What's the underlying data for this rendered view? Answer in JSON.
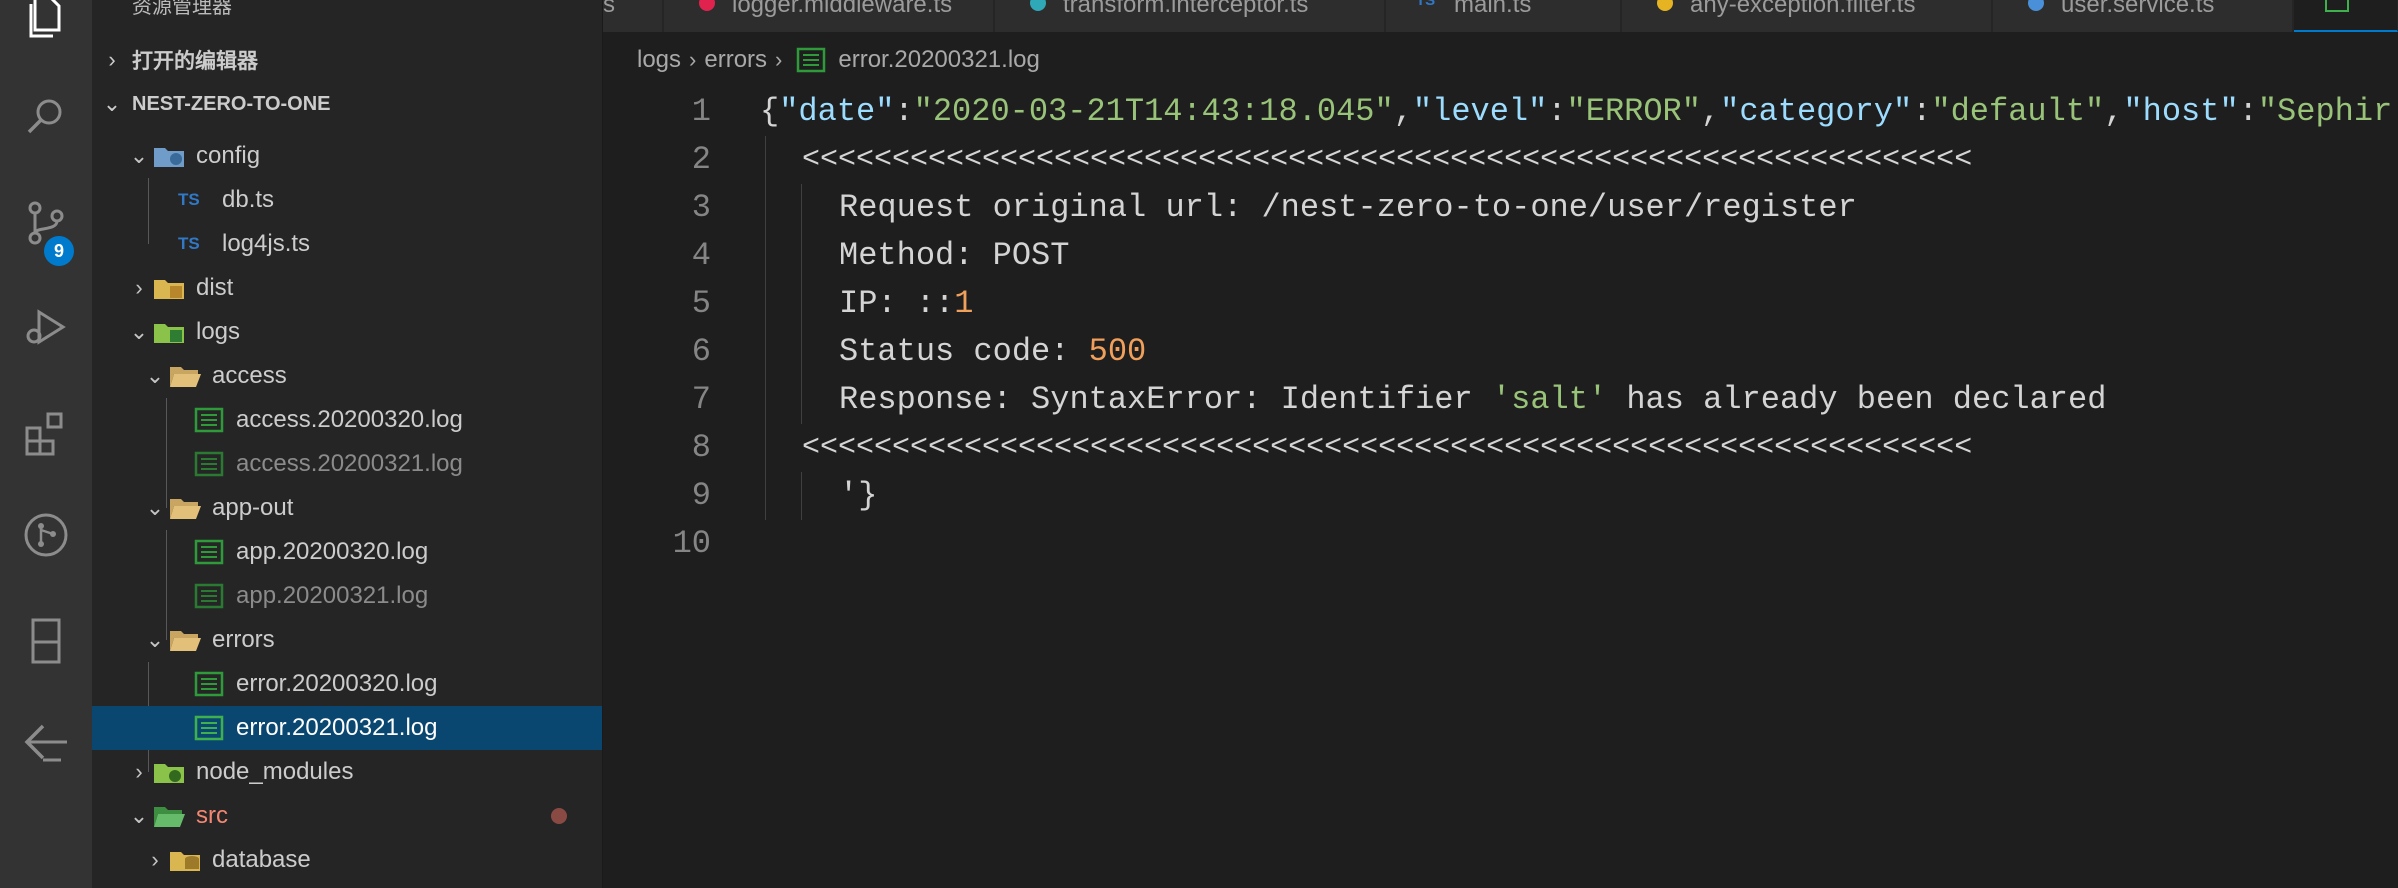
{
  "sidebar": {
    "title": "资源管理器",
    "open_editors_label": "打开的编辑器",
    "project_label": "NEST-ZERO-TO-ONE",
    "items": [
      {
        "label": "config",
        "kind": "folder",
        "state": "open"
      },
      {
        "label": "db.ts",
        "kind": "ts"
      },
      {
        "label": "log4js.ts",
        "kind": "ts"
      },
      {
        "label": "dist",
        "kind": "folder",
        "state": "closed"
      },
      {
        "label": "logs",
        "kind": "folder",
        "state": "open"
      },
      {
        "label": "access",
        "kind": "folder",
        "state": "open"
      },
      {
        "label": "access.20200320.log",
        "kind": "log"
      },
      {
        "label": "access.20200321.log",
        "kind": "log"
      },
      {
        "label": "app-out",
        "kind": "folder",
        "state": "open"
      },
      {
        "label": "app.20200320.log",
        "kind": "log"
      },
      {
        "label": "app.20200321.log",
        "kind": "log"
      },
      {
        "label": "errors",
        "kind": "folder",
        "state": "open"
      },
      {
        "label": "error.20200320.log",
        "kind": "log"
      },
      {
        "label": "error.20200321.log",
        "kind": "log",
        "selected": true
      },
      {
        "label": "node_modules",
        "kind": "folder",
        "state": "closed"
      },
      {
        "label": "src",
        "kind": "folder",
        "state": "open"
      },
      {
        "label": "database",
        "kind": "folder",
        "state": "closed"
      }
    ]
  },
  "activity": {
    "scm_badge": "9",
    "icons": [
      "explorer-icon",
      "search-icon",
      "source-control-icon",
      "run-debug-icon",
      "extensions-icon",
      "git-graph-icon",
      "remote-explorer-icon",
      "deploy-icon"
    ]
  },
  "tabs": [
    {
      "label": "s"
    },
    {
      "label": "logger.middleware.ts"
    },
    {
      "label": "transform.interceptor.ts"
    },
    {
      "label": "main.ts"
    },
    {
      "label": "any-exception.filter.ts"
    },
    {
      "label": "user.service.ts"
    }
  ],
  "breadcrumb": {
    "part1": "logs",
    "part2": "errors",
    "file": "error.20200321.log"
  },
  "editor": {
    "line_numbers": [
      "1",
      "2",
      "3",
      "4",
      "5",
      "6",
      "7",
      "8",
      "9",
      "10"
    ],
    "line1": {
      "p1": "{",
      "k1": "\"date\"",
      "c1": ":",
      "v1": "\"2020-03-21T14:43:18.045\"",
      "c2": ",",
      "k2": "\"level\"",
      "c3": ":",
      "v2": "\"ERROR\"",
      "c4": ",",
      "k3": "\"category\"",
      "c5": ":",
      "v3": "\"default\"",
      "c6": ",",
      "k4": "\"host\"",
      "c7": ":",
      "v4": "\"Sephir"
    },
    "line2": "<<<<<<<<<<<<<<<<<<<<<<<<<<<<<<<<<<<<<<<<<<<<<<<<<<<<<<<<<<<<<<<<<",
    "line3": "Request original url: /nest-zero-to-one/user/register",
    "line4": "Method: POST",
    "line5_a": "IP: ::",
    "line5_b": "1",
    "line6_a": "Status code: ",
    "line6_b": "500",
    "line7_a": "Response: SyntaxError: Identifier ",
    "line7_b": "'salt'",
    "line7_c": " has already been declared",
    "line8": "<<<<<<<<<<<<<<<<<<<<<<<<<<<<<<<<<<<<<<<<<<<<<<<<<<<<<<<<<<<<<<<<<",
    "line9": "'}"
  },
  "colors": {
    "accent": "#007acc",
    "selection": "#094771",
    "json_key": "#9cdcfe",
    "string_green": "#98c379",
    "number_orange": "#f0a05a"
  }
}
